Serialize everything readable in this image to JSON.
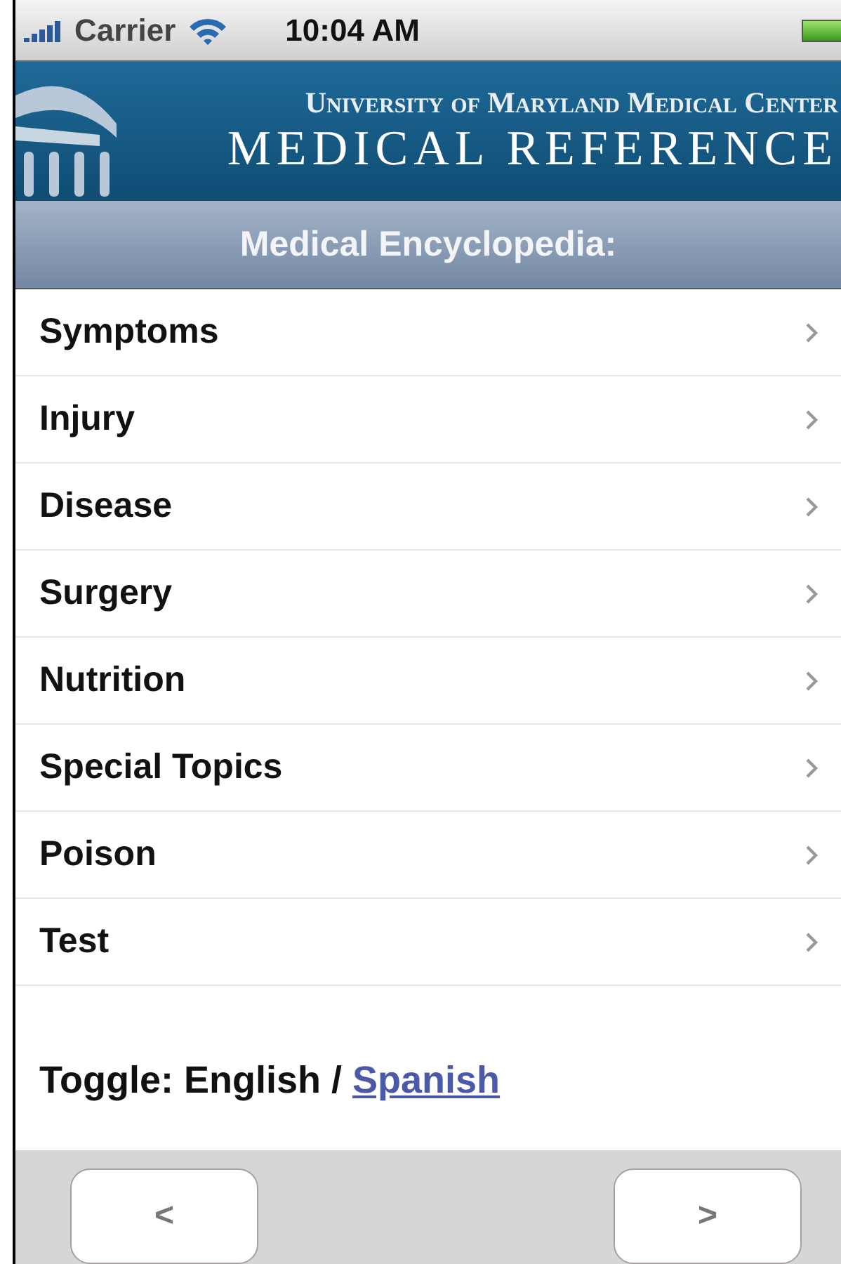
{
  "status_bar": {
    "carrier": "Carrier",
    "time": "10:04 AM"
  },
  "banner": {
    "line_1": "University of Maryland Medical Center",
    "line_2": "MEDICAL REFERENCE"
  },
  "title": "Medical Encyclopedia:",
  "items": [
    {
      "label": "Symptoms"
    },
    {
      "label": "Injury"
    },
    {
      "label": "Disease"
    },
    {
      "label": "Surgery"
    },
    {
      "label": "Nutrition"
    },
    {
      "label": "Special Topics"
    },
    {
      "label": "Poison"
    },
    {
      "label": "Test"
    }
  ],
  "toggle": {
    "text": "Toggle: English / ",
    "link": "Spanish"
  },
  "toolbar": {
    "back": "<",
    "forward": ">"
  }
}
